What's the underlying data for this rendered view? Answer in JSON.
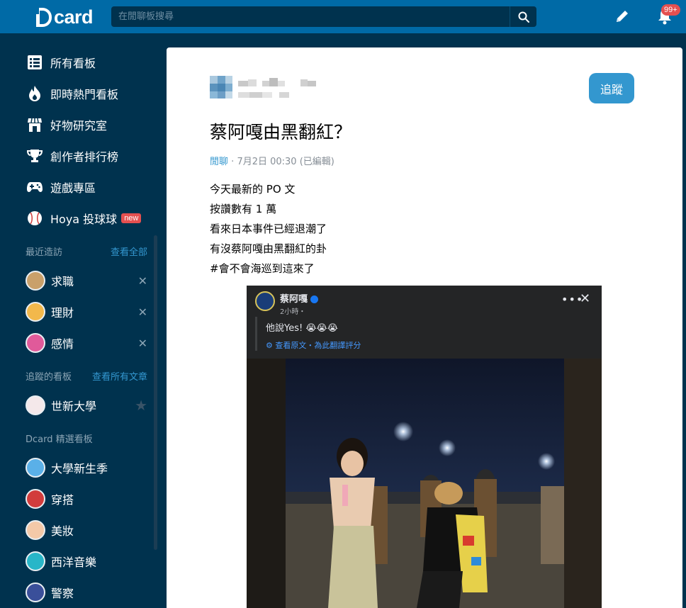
{
  "topbar": {
    "logo_text": "card",
    "search_placeholder": "在閒聊板搜尋",
    "notification_count": "99+"
  },
  "sidebar": {
    "nav": [
      {
        "label": "所有看板",
        "icon": "list-icon"
      },
      {
        "label": "即時熱門看板",
        "icon": "fire-icon"
      },
      {
        "label": "好物研究室",
        "icon": "store-icon"
      },
      {
        "label": "創作者排行榜",
        "icon": "trophy-icon"
      },
      {
        "label": "遊戲專區",
        "icon": "gamepad-icon"
      },
      {
        "label": "Hoya 投球球",
        "icon": "baseball-icon",
        "tag": "new"
      }
    ],
    "recent": {
      "title": "最近造訪",
      "link": "查看全部",
      "items": [
        {
          "label": "求職",
          "color": "#c9a06a"
        },
        {
          "label": "理財",
          "color": "#f2b84b"
        },
        {
          "label": "感情",
          "color": "#e05a9a"
        }
      ]
    },
    "following": {
      "title": "追蹤的看板",
      "link": "查看所有文章",
      "items": [
        {
          "label": "世新大學",
          "color": "#c0394a"
        }
      ]
    },
    "featured": {
      "title": "Dcard 精選看板",
      "items": [
        {
          "label": "大學新生季",
          "color": "#5ab0e8"
        },
        {
          "label": "穿搭",
          "color": "#d23c3c"
        },
        {
          "label": "美妝",
          "color": "#f4c9a8"
        },
        {
          "label": "西洋音樂",
          "color": "#28b6c8"
        },
        {
          "label": "警察",
          "color": "#3a4f9a"
        }
      ]
    }
  },
  "post": {
    "follow_label": "追蹤",
    "title": "蔡阿嘎由黑翻紅？",
    "forum": "閒聊",
    "separator": "·",
    "time": "7月2日 00:30 (已編輯)",
    "lines": [
      "今天最新的 PO 文",
      "按讚數有 1 萬",
      "看來日本事件已經退潮了",
      "有沒蔡阿嘎由黑翻紅的卦",
      "#會不會海巡到這來了"
    ],
    "embed": {
      "name": "蔡阿嘎",
      "time": "2小時・",
      "text": "他說Yes! 😭😭😭",
      "translate": "查看原文・為此翻譯評分",
      "more": "•••",
      "close": "✕"
    }
  },
  "colors": {
    "topbar": "#006aa6",
    "sidebar": "#00324e",
    "accent": "#3397cf",
    "badge": "#e45050"
  }
}
